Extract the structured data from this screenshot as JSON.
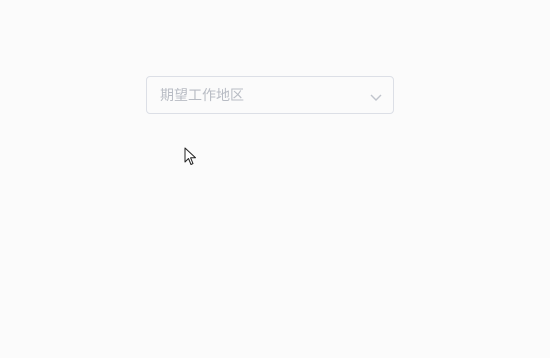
{
  "select": {
    "placeholder": "期望工作地区",
    "value": ""
  },
  "icons": {
    "dropdown": "chevron-down-icon",
    "cursor": "mouse-pointer-icon"
  },
  "colors": {
    "background": "#fbfbfb",
    "border": "#dcdfe6",
    "placeholder": "#b8bcc4",
    "chevron": "#c0c4cc"
  }
}
